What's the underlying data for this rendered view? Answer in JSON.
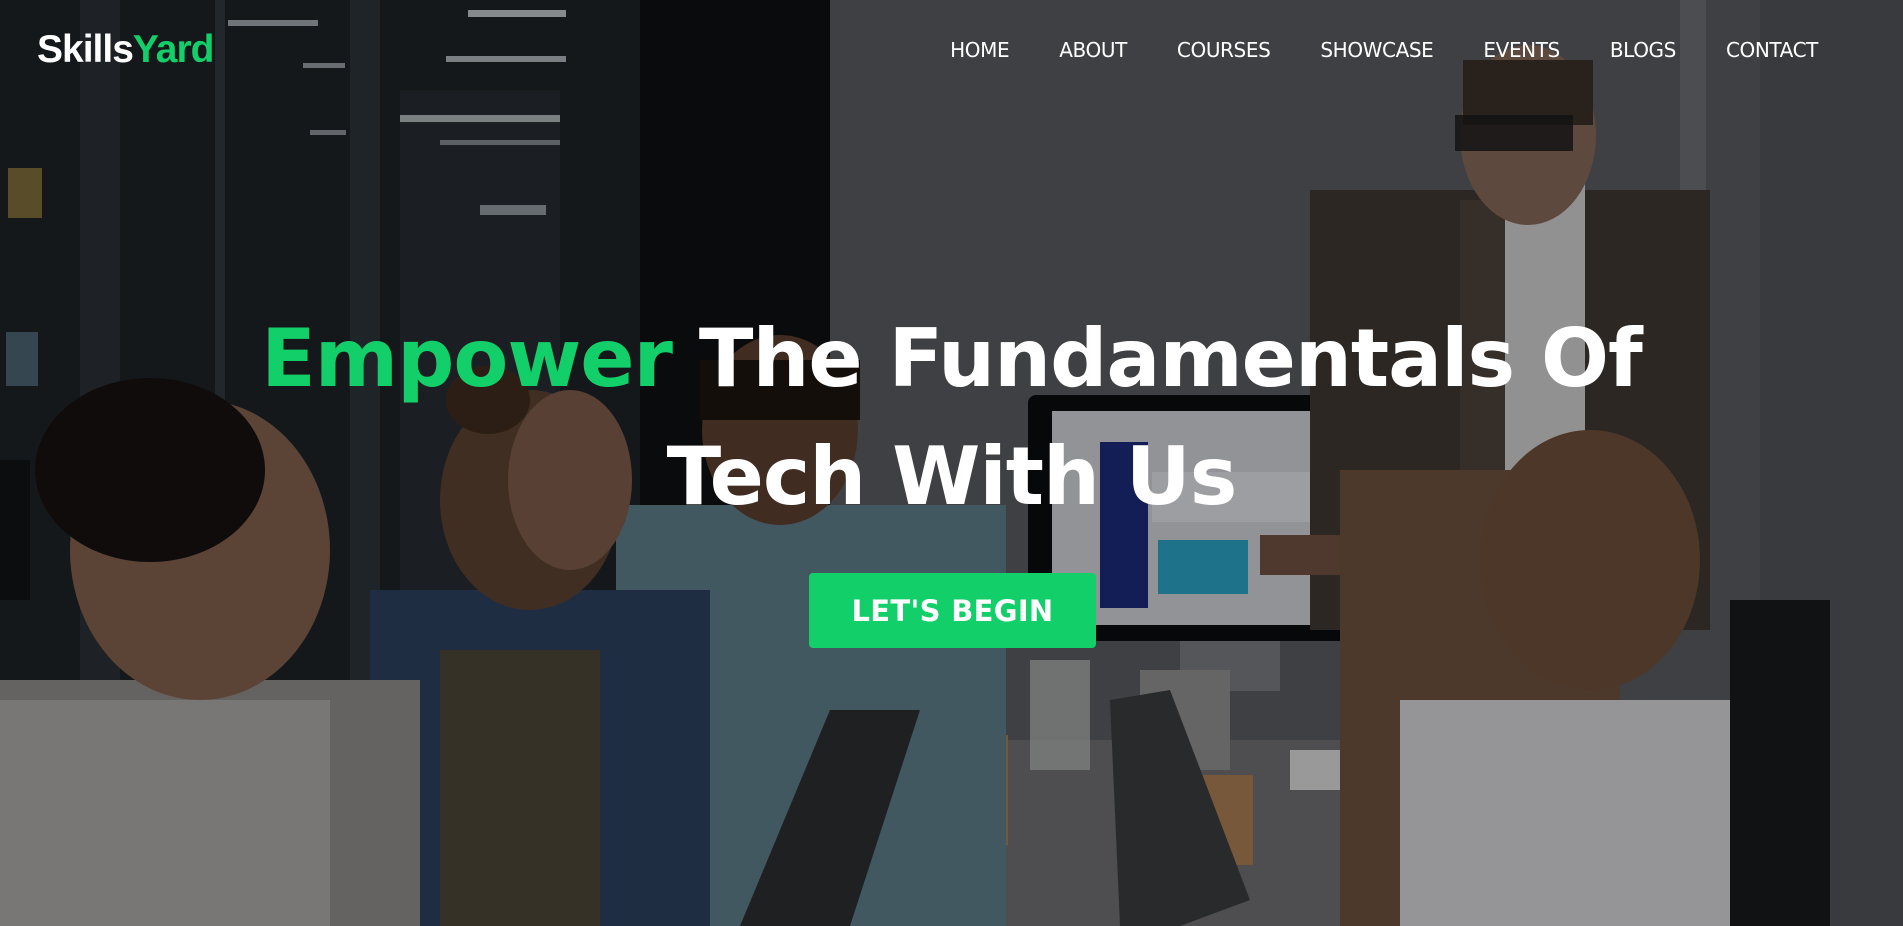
{
  "brand": {
    "logo_part1": "Skills",
    "logo_part2": "Yard",
    "accent_color": "#13cf6a"
  },
  "nav": {
    "items": [
      {
        "label": "HOME"
      },
      {
        "label": "ABOUT"
      },
      {
        "label": "COURSES"
      },
      {
        "label": "SHOWCASE"
      },
      {
        "label": "EVENTS"
      },
      {
        "label": "BLOGS"
      },
      {
        "label": "CONTACT"
      }
    ]
  },
  "hero": {
    "headline_accent": "Empower",
    "headline_line1_rest": " The Fundamentals Of",
    "headline_line2": "Tech With Us",
    "cta_label": "LET'S BEGIN",
    "background": "team-meeting-photo"
  }
}
